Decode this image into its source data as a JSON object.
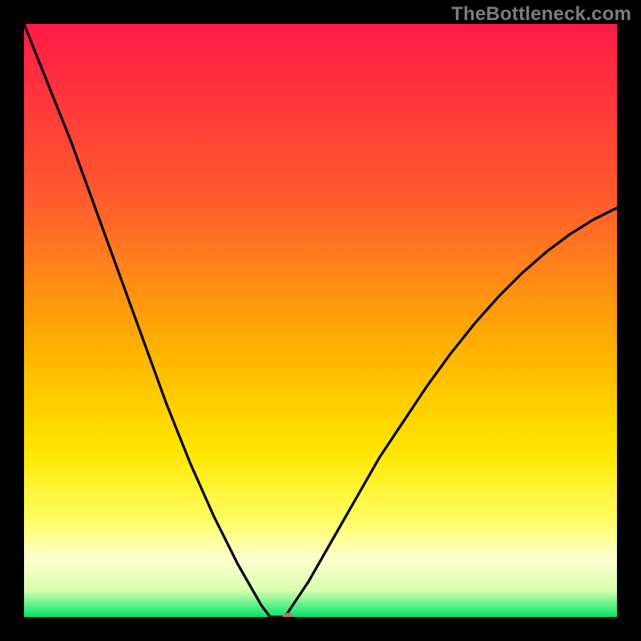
{
  "watermark": "TheBottleneck.com",
  "chart_data": {
    "type": "line",
    "title": "",
    "xlabel": "",
    "ylabel": "",
    "xlim": [
      0,
      100
    ],
    "ylim": [
      0,
      100
    ],
    "gradient_stops": [
      {
        "offset": 0.0,
        "color": "#ff1a46"
      },
      {
        "offset": 0.3,
        "color": "#ff5d2e"
      },
      {
        "offset": 0.55,
        "color": "#ffb300"
      },
      {
        "offset": 0.72,
        "color": "#ffe600"
      },
      {
        "offset": 0.84,
        "color": "#ffff66"
      },
      {
        "offset": 0.9,
        "color": "#ffffd0"
      },
      {
        "offset": 0.955,
        "color": "#d8ffb0"
      },
      {
        "offset": 1.0,
        "color": "#00e56a"
      }
    ],
    "curve_left": {
      "x": [
        0,
        4,
        8,
        12,
        16,
        20,
        24,
        28,
        32,
        36,
        40,
        41.5
      ],
      "y": [
        100,
        90,
        80,
        69,
        58,
        47,
        36,
        26,
        17,
        9,
        2,
        0
      ]
    },
    "curve_flat": {
      "x": [
        41.5,
        44.0
      ],
      "y": [
        0,
        0
      ]
    },
    "curve_right": {
      "x": [
        44.0,
        48,
        52,
        56,
        60,
        64,
        68,
        72,
        76,
        80,
        84,
        88,
        92,
        96,
        100
      ],
      "y": [
        0,
        6,
        13,
        20,
        27,
        33,
        39,
        44.5,
        49.5,
        54,
        58,
        61.5,
        64.5,
        67,
        69
      ]
    },
    "marker": {
      "x": 44.5,
      "y": 0,
      "color": "#c76a6a",
      "rx": 7,
      "ry": 5
    }
  }
}
